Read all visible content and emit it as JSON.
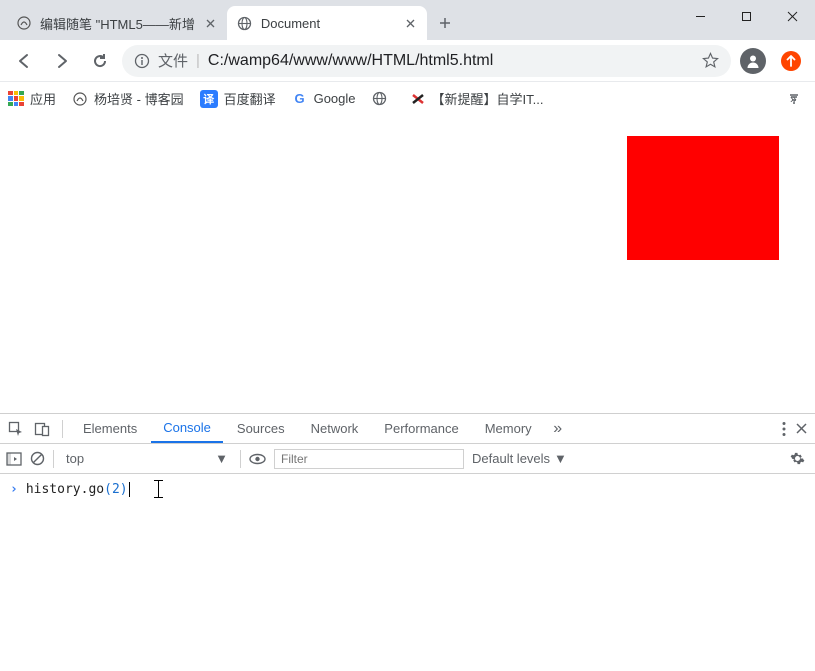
{
  "window": {
    "minimize": "—",
    "maximize": "□",
    "close": "✕"
  },
  "tabs": [
    {
      "title": "编辑随笔 \"HTML5——新增",
      "active": false
    },
    {
      "title": "Document",
      "active": true
    }
  ],
  "nav": {
    "back": "←",
    "forward": "→",
    "reload": "⟳"
  },
  "omnibox": {
    "info_icon": "ⓘ",
    "prefix": "文件",
    "separator": "|",
    "url": "C:/wamp64/www/www/HTML/html5.html"
  },
  "bookmarks": {
    "apps": "应用",
    "items": [
      {
        "label": "杨培贤 - 博客园"
      },
      {
        "label": "百度翻译"
      },
      {
        "label": "Google"
      },
      {
        "label": ""
      },
      {
        "label": "【新提醒】自学IT..."
      }
    ]
  },
  "page": {
    "box_color": "#ff0000"
  },
  "devtools": {
    "tabs": [
      "Elements",
      "Console",
      "Sources",
      "Network",
      "Performance",
      "Memory"
    ],
    "active_tab": "Console",
    "context": "top",
    "filter_placeholder": "Filter",
    "levels": "Default levels",
    "input": {
      "ident1": "history",
      "dot": ".",
      "ident2": "go",
      "lparen": "(",
      "arg": "2",
      "rparen": ")"
    }
  }
}
